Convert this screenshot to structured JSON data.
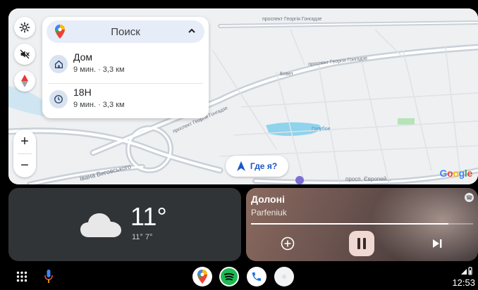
{
  "map": {
    "search_label": "Поиск",
    "destinations": [
      {
        "title": "Дом",
        "subtitle": "9 мин. · 3,3 км",
        "icon": "home-icon"
      },
      {
        "title": "18H",
        "subtitle": "9 мин. · 3,3 км",
        "icon": "history-icon"
      }
    ],
    "where_am_i_label": "Где я?",
    "attribution": "Google",
    "street_labels": [
      "проспект Георгія Гонгадзе",
      "проспект Георгія Гонгадзе",
      "проспект Георгія Гонгадзе",
      "Івана Виговського",
      "просп. Європей...",
      "Бовет",
      "Голубое"
    ],
    "zoom_in": "+",
    "zoom_out": "−",
    "colors": {
      "accent": "#1a56c8",
      "water": "#8fd3ec",
      "park": "#b7e3b8"
    }
  },
  "weather": {
    "temperature": "11°",
    "range": "11° 7°",
    "icon": "cloud-icon"
  },
  "media": {
    "song": "Долоні",
    "artist": "Parfeniuk",
    "progress": 0.89,
    "icons": [
      "spotify-icon",
      "add-icon",
      "pause-icon",
      "skip-next-icon"
    ]
  },
  "bottombar": {
    "time": "12:53",
    "apps": [
      "google-maps",
      "spotify",
      "phone",
      "assistant"
    ],
    "colors": {
      "spotify": "#1db954",
      "phone": "#1a73e8"
    }
  }
}
